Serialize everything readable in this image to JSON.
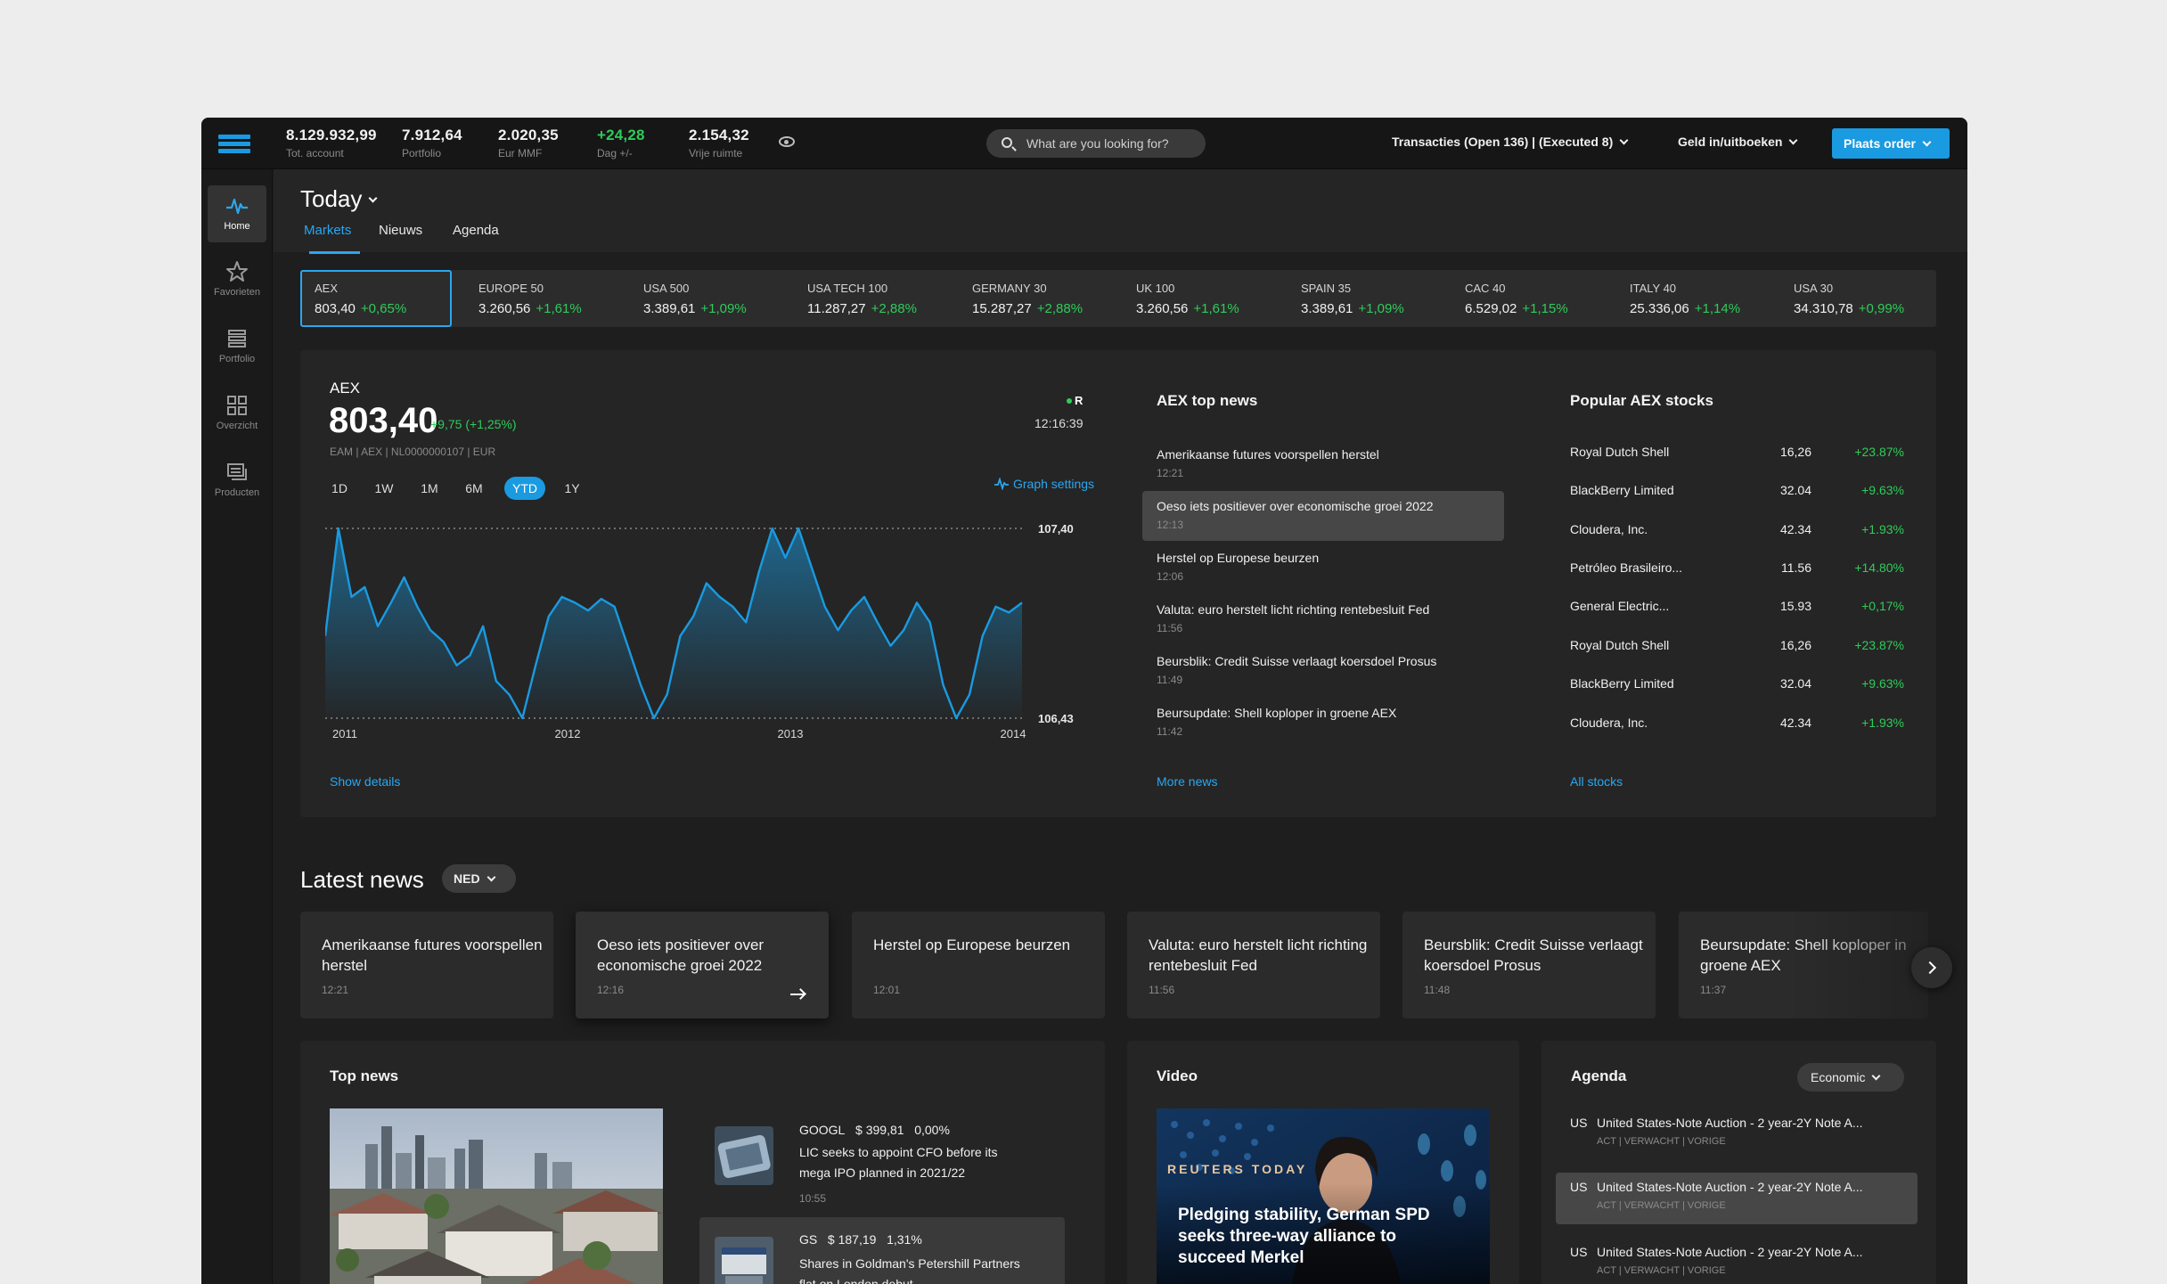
{
  "topbar": {
    "stats": [
      {
        "value": "8.129.932,99",
        "label": "Tot. account"
      },
      {
        "value": "7.912,64",
        "label": "Portfolio"
      },
      {
        "value": "2.020,35",
        "label": "Eur MMF"
      },
      {
        "value": "+24,28",
        "label": "Dag +/-"
      },
      {
        "value": "2.154,32",
        "label": "Vrije ruimte"
      }
    ],
    "search_placeholder": "What are you looking for?",
    "transactions": "Transacties (Open 136) | (Executed 8)",
    "money": "Geld in/uitboeken",
    "order_button": "Plaats order"
  },
  "sidebar": {
    "items": [
      {
        "label": "Home",
        "icon": "pulse-icon"
      },
      {
        "label": "Favorieten",
        "icon": "star-icon"
      },
      {
        "label": "Portfolio",
        "icon": "list-icon"
      },
      {
        "label": "Overzicht",
        "icon": "grid-icon"
      },
      {
        "label": "Producten",
        "icon": "stack-icon"
      }
    ]
  },
  "header": {
    "title": "Today",
    "tabs": [
      "Markets",
      "Nieuws",
      "Agenda"
    ]
  },
  "indices": [
    {
      "name": "AEX",
      "value": "803,40",
      "change": "+0,65%"
    },
    {
      "name": "EUROPE 50",
      "value": "3.260,56",
      "change": "+1,61%"
    },
    {
      "name": "USA 500",
      "value": "3.389,61",
      "change": "+1,09%"
    },
    {
      "name": "USA TECH 100",
      "value": "11.287,27",
      "change": "+2,88%"
    },
    {
      "name": "GERMANY 30",
      "value": "15.287,27",
      "change": "+2,88%"
    },
    {
      "name": "UK 100",
      "value": "3.260,56",
      "change": "+1,61%"
    },
    {
      "name": "SPAIN 35",
      "value": "3.389,61",
      "change": "+1,09%"
    },
    {
      "name": "CAC 40",
      "value": "6.529,02",
      "change": "+1,15%"
    },
    {
      "name": "ITALY 40",
      "value": "25.336,06",
      "change": "+1,14%"
    },
    {
      "name": "USA 30",
      "value": "34.310,78",
      "change": "+0,99%"
    }
  ],
  "aex": {
    "label": "AEX",
    "value": "803,40",
    "change": "+9,75 (+1,25%)",
    "meta": "EAM | AEX | NL0000000107 | EUR",
    "live": "R",
    "time": "12:16:39",
    "periods": [
      "1D",
      "1W",
      "1M",
      "6M",
      "YTD",
      "1Y"
    ],
    "graph_settings": "Graph settings",
    "show_details": "Show details"
  },
  "chart_data": {
    "type": "area",
    "x_ticks": [
      "2011",
      "2012",
      "2013",
      "2014"
    ],
    "y_labels": {
      "max": "107,40",
      "min": "106,43"
    },
    "ylim": [
      106.43,
      107.4
    ],
    "color": "#1a9ae0",
    "values": [
      106.85,
      107.4,
      107.05,
      107.1,
      106.9,
      107.02,
      107.15,
      107.0,
      106.88,
      106.82,
      106.7,
      106.75,
      106.9,
      106.62,
      106.55,
      106.43,
      106.7,
      106.95,
      107.05,
      107.02,
      106.98,
      107.04,
      107.0,
      106.8,
      106.6,
      106.43,
      106.55,
      106.85,
      106.95,
      107.12,
      107.05,
      107.0,
      106.92,
      107.18,
      107.4,
      107.25,
      107.4,
      107.2,
      107.0,
      106.88,
      106.98,
      107.05,
      106.92,
      106.8,
      106.88,
      107.02,
      106.92,
      106.6,
      106.43,
      106.55,
      106.85,
      107.0,
      106.97,
      107.02
    ]
  },
  "top_news": {
    "title": "AEX top news",
    "items": [
      {
        "title": "Amerikaanse futures voorspellen herstel",
        "time": "12:21"
      },
      {
        "title": "Oeso iets positiever over economische groei 2022",
        "time": "12:13"
      },
      {
        "title": "Herstel op Europese beurzen",
        "time": "12:06"
      },
      {
        "title": "Valuta: euro herstelt licht richting rentebesluit Fed",
        "time": "11:56"
      },
      {
        "title": "Beursblik: Credit Suisse verlaagt koersdoel Prosus",
        "time": "11:49"
      },
      {
        "title": "Beursupdate: Shell koploper in groene AEX",
        "time": "11:42"
      }
    ],
    "more": "More news"
  },
  "popular": {
    "title": "Popular AEX stocks",
    "rows": [
      {
        "name": "Royal Dutch Shell",
        "price": "16,26",
        "change": "+23.87%"
      },
      {
        "name": "BlackBerry Limited",
        "price": "32.04",
        "change": "+9.63%"
      },
      {
        "name": "Cloudera, Inc.",
        "price": "42.34",
        "change": "+1.93%"
      },
      {
        "name": "Petróleo Brasileiro...",
        "price": "11.56",
        "change": "+14.80%"
      },
      {
        "name": "General Electric...",
        "price": "15.93",
        "change": "+0,17%"
      },
      {
        "name": "Royal Dutch Shell",
        "price": "16,26",
        "change": "+23.87%"
      },
      {
        "name": "BlackBerry Limited",
        "price": "32.04",
        "change": "+9.63%"
      },
      {
        "name": "Cloudera, Inc.",
        "price": "42.34",
        "change": "+1.93%"
      }
    ],
    "all": "All stocks"
  },
  "latest": {
    "title": "Latest news",
    "filter": "NED",
    "cards": [
      {
        "title": "Amerikaanse futures voorspellen herstel",
        "time": "12:21"
      },
      {
        "title": "Oeso iets positiever over economische groei 2022",
        "time": "12:16"
      },
      {
        "title": "Herstel op Europese beurzen",
        "time": "12:01"
      },
      {
        "title": "Valuta: euro herstelt licht richting rentebesluit Fed",
        "time": "11:56"
      },
      {
        "title": "Beursblik: Credit Suisse verlaagt koersdoel Prosus",
        "time": "11:48"
      },
      {
        "title": "Beursupdate: Shell koploper in groene AEX",
        "time": "11:37"
      }
    ]
  },
  "top_news_section": {
    "title": "Top news",
    "items": [
      {
        "ticker": "GOOGL",
        "price": "$ 399,81",
        "change": "0,00%",
        "title": "LIC seeks to appoint CFO before its mega IPO planned in 2021/22",
        "time": "10:55"
      },
      {
        "ticker": "GS",
        "price": "$ 187,19",
        "change": "1,31%",
        "title": "Shares in Goldman's Petershill Partners flat on London debut",
        "time": ""
      }
    ]
  },
  "video": {
    "title": "Video",
    "source": "REUTERS TODAY",
    "caption": "Pledging stability, German SPD seeks three-way alliance to succeed Merkel"
  },
  "agenda": {
    "title": "Agenda",
    "filter": "Economic",
    "rows": [
      {
        "country": "US",
        "title": "United States-Note Auction - 2 year-2Y Note A...",
        "sub": "ACT | VERWACHT | VORIGE"
      },
      {
        "country": "US",
        "title": "United States-Note Auction - 2 year-2Y Note A...",
        "sub": "ACT | VERWACHT | VORIGE"
      },
      {
        "country": "US",
        "title": "United States-Note Auction - 2 year-2Y Note A...",
        "sub": "ACT | VERWACHT | VORIGE"
      }
    ]
  }
}
